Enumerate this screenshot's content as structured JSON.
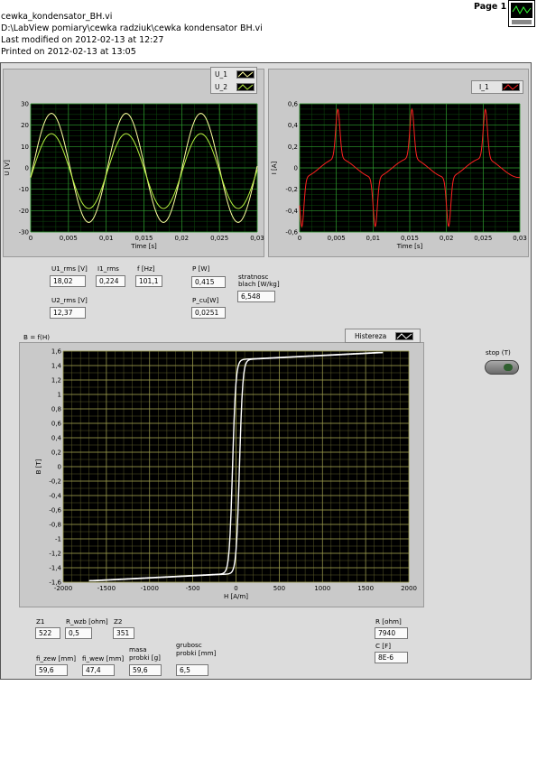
{
  "header": {
    "vi_name": "cewka_kondensator_BH.vi",
    "path": "D:\\LabView pomiary\\cewka radziuk\\cewka kondensator BH.vi",
    "modified": "Last modified on 2012-02-13 at 12:27",
    "printed": "Printed on 2012-02-13 at 13:05",
    "page": "Page 1"
  },
  "graph_u": {
    "legend": [
      "U_1",
      "U_2"
    ],
    "ylabel": "U [V]",
    "xlabel": "Time [s]",
    "yticks": [
      "30",
      "20",
      "10",
      "0",
      "-10",
      "-20",
      "-30"
    ],
    "xticks": [
      "0",
      "0,005",
      "0,01",
      "0,015",
      "0,02",
      "0,025",
      "0,03"
    ]
  },
  "graph_i": {
    "legend": [
      "I_1"
    ],
    "ylabel": "I [A]",
    "xlabel": "Time [s]",
    "yticks": [
      "0,6",
      "0,4",
      "0,2",
      "0",
      "-0,2",
      "-0,4",
      "-0,6"
    ],
    "xticks": [
      "0",
      "0,005",
      "0,01",
      "0,015",
      "0,02",
      "0,025",
      "0,03"
    ]
  },
  "measurements": {
    "u1_rms_label": "U1_rms [V]",
    "u1_rms": "18,02",
    "i1_rms_label": "I1_rms",
    "i1_rms": "0,224",
    "f_label": "f [Hz]",
    "f": "101,1",
    "p_label": "P [W]",
    "p": "0,415",
    "stratnosc_label_1": "stratnosc",
    "stratnosc_label_2": "blach [W/kg]",
    "stratnosc": "6,548",
    "u2_rms_label": "U2_rms [V]",
    "u2_rms": "12,37",
    "p_cu_label": "P_cu[W]",
    "p_cu": "0,0251"
  },
  "graph_bh": {
    "title": "B = f(H)",
    "legend": "Histereza",
    "ylabel": "B [T]",
    "xlabel": "H [A/m]",
    "yticks": [
      "1,6",
      "1,4",
      "1,2",
      "1",
      "0,8",
      "0,6",
      "0,4",
      "0,2",
      "0",
      "-0,2",
      "-0,4",
      "-0,6",
      "-0,8",
      "-1",
      "-1,2",
      "-1,4",
      "-1,6"
    ],
    "xticks": [
      "-2000",
      "-1500",
      "-1000",
      "-500",
      "0",
      "500",
      "1000",
      "1500",
      "2000"
    ]
  },
  "stop": {
    "label": "stop (T)"
  },
  "params": {
    "z1_label": "Z1",
    "z1": "522",
    "r_wzb_label": "R_wzb [ohm]",
    "r_wzb": "0,5",
    "z2_label": "Z2",
    "z2": "351",
    "r_label": "R [ohm]",
    "r": "7940",
    "c_label": "C [F]",
    "c": "8E-6",
    "fi_zew_label": "fi_zew [mm]",
    "fi_zew": "59,6",
    "fi_wew_label": "fi_wew [mm]",
    "fi_wew": "47,4",
    "masa_label_1": "masa",
    "masa_label_2": "probki [g]",
    "masa": "59,6",
    "grubosc_label_1": "grubosc",
    "grubosc_label_2": "probki [mm]",
    "grubosc": "6,5"
  },
  "colors": {
    "u1": "#ffffa0",
    "u2": "#b8f040",
    "i1": "#ff2020",
    "bh": "#ffffff",
    "grid_major": "#2e9a2e",
    "grid_minor": "#0d4a0d",
    "bh_grid_major": "#a0a050",
    "bh_grid_minor": "#5a5a28"
  },
  "chart_data": [
    {
      "type": "line",
      "xlabel": "Time [s]",
      "ylabel": "U [V]",
      "xlim": [
        0,
        0.03
      ],
      "ylim": [
        -30,
        30
      ],
      "series": [
        {
          "name": "U_1",
          "amplitude": 25.5,
          "offset": 0,
          "frequency_hz": 101.1,
          "phase_deg": -10
        },
        {
          "name": "U_2",
          "amplitude": 17.5,
          "offset": -1.5,
          "frequency_hz": 101.1,
          "phase_deg": -10
        }
      ]
    },
    {
      "type": "line",
      "xlabel": "Time [s]",
      "ylabel": "I [A]",
      "xlim": [
        0,
        0.03
      ],
      "ylim": [
        -0.6,
        0.6
      ],
      "series": [
        {
          "name": "I_1",
          "peak": 0.55,
          "plateau": 0.09,
          "peak_times_s": [
            0.0052,
            0.0153,
            0.0253
          ],
          "trough_times_s": [
            0.0003,
            0.0103,
            0.0203
          ]
        }
      ]
    },
    {
      "type": "line",
      "title": "B = f(H)",
      "xlabel": "H [A/m]",
      "ylabel": "B [T]",
      "xlim": [
        -2000,
        2000
      ],
      "ylim": [
        -1.6,
        1.6
      ],
      "series": [
        {
          "name": "Histereza",
          "h_max": 1700,
          "b_max": 1.58,
          "coercive_h": 40,
          "b_at_h0": 0.9
        }
      ]
    }
  ]
}
